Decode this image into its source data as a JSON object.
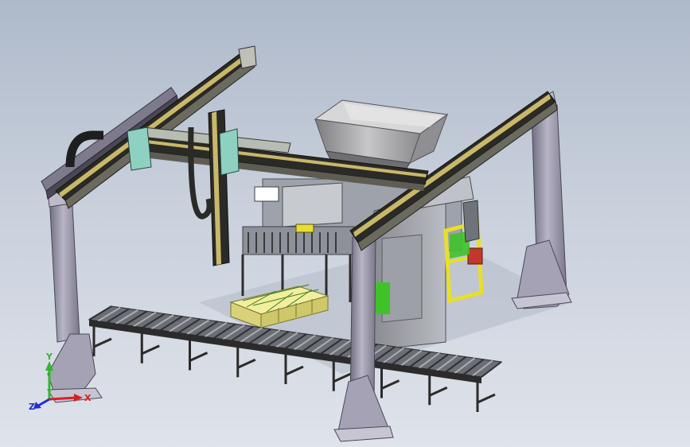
{
  "viewport": {
    "background_top": "#aeb9ca",
    "background_bottom": "#dfe3ea"
  },
  "model": {
    "frame_color": "#9a97ab",
    "beam_color": "#2a2a26",
    "rail_color": "#c9b86a",
    "conveyor_color": "#2b2b2b",
    "roller_color": "#9fa3aa",
    "hopper_color": "#a8a8aa",
    "product_color": "#e6e08a",
    "accent_green": "#3fc22a",
    "accent_yellow": "#e8df2a",
    "accent_red": "#c0392b"
  },
  "triad": {
    "x_label": "X",
    "y_label": "Y",
    "z_label": "Z",
    "x_color": "#d62020",
    "y_color": "#2fb82f",
    "z_color": "#2030d0"
  }
}
